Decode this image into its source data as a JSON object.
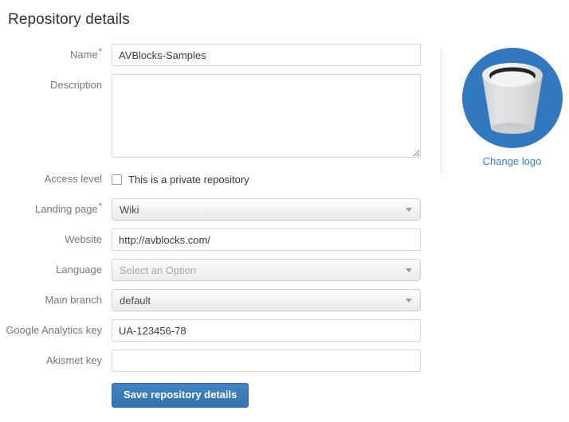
{
  "page": {
    "title": "Repository details"
  },
  "form": {
    "fields": [
      {
        "key": "name",
        "label": "Name",
        "required": true,
        "type": "text",
        "value": "AVBlocks-Samples",
        "placeholder": ""
      },
      {
        "key": "description",
        "label": "Description",
        "required": false,
        "type": "textarea",
        "value": "",
        "placeholder": ""
      },
      {
        "key": "access_level",
        "label": "Access level",
        "required": false,
        "type": "checkbox",
        "checkbox_label": "This is a private repository",
        "checked": false
      },
      {
        "key": "landing_page",
        "label": "Landing page",
        "required": true,
        "type": "select",
        "value": "Wiki",
        "is_placeholder": false
      },
      {
        "key": "website",
        "label": "Website",
        "required": false,
        "type": "text",
        "value": "http://avblocks.com/",
        "placeholder": ""
      },
      {
        "key": "language",
        "label": "Language",
        "required": false,
        "type": "select",
        "value": "Select an Option",
        "is_placeholder": true
      },
      {
        "key": "main_branch",
        "label": "Main branch",
        "required": true,
        "type": "select",
        "value": "default",
        "is_placeholder": false
      },
      {
        "key": "google_analytics_key",
        "label": "Google Analytics key",
        "required": false,
        "type": "text",
        "value": "UA-123456-78",
        "placeholder": ""
      },
      {
        "key": "akismet_key",
        "label": "Akismet key",
        "required": false,
        "type": "text",
        "value": "",
        "placeholder": ""
      }
    ],
    "submit_label": "Save repository details",
    "required_marker": "*"
  },
  "logo": {
    "icon_name": "bucket-logo",
    "change_label": "Change logo"
  },
  "colors": {
    "accent_blue": "#3178be",
    "button_blue": "#3573ad",
    "link_blue": "#3c7cbf",
    "required_red": "#d9534f",
    "label_gray": "#777777",
    "border_gray": "#d5d5d5",
    "page_background": "#ffffff"
  }
}
